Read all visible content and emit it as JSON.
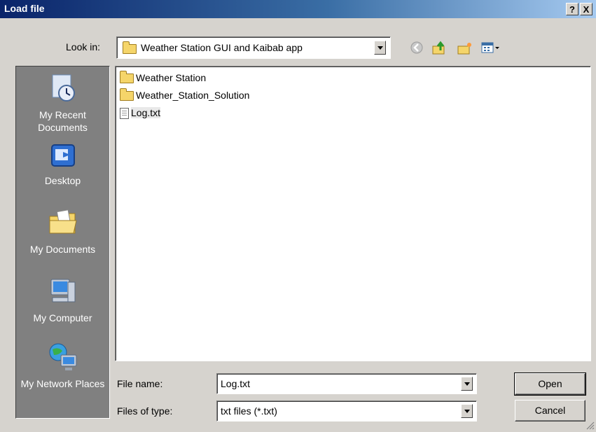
{
  "window": {
    "title": "Load file",
    "help_label": "?",
    "close_label": "X"
  },
  "look_in": {
    "label": "Look in:",
    "value": "Weather Station GUI and Kaibab app"
  },
  "toolbar": {
    "icons": [
      "back-icon",
      "up-folder-icon",
      "new-folder-icon",
      "view-menu-icon"
    ]
  },
  "places": [
    {
      "label": "My Recent Documents",
      "icon": "recent-documents-icon"
    },
    {
      "label": "Desktop",
      "icon": "desktop-icon"
    },
    {
      "label": "My Documents",
      "icon": "my-documents-icon"
    },
    {
      "label": "My Computer",
      "icon": "my-computer-icon"
    },
    {
      "label": "My Network Places",
      "icon": "network-places-icon"
    }
  ],
  "files": [
    {
      "name": "Weather Station",
      "type": "folder"
    },
    {
      "name": "Weather_Station_Solution",
      "type": "folder"
    },
    {
      "name": "Log.txt",
      "type": "file",
      "selected": true
    }
  ],
  "file_name": {
    "label": "File name:",
    "value": "Log.txt"
  },
  "file_type": {
    "label": "Files of type:",
    "value": "txt files (*.txt)"
  },
  "buttons": {
    "open": "Open",
    "cancel": "Cancel"
  }
}
